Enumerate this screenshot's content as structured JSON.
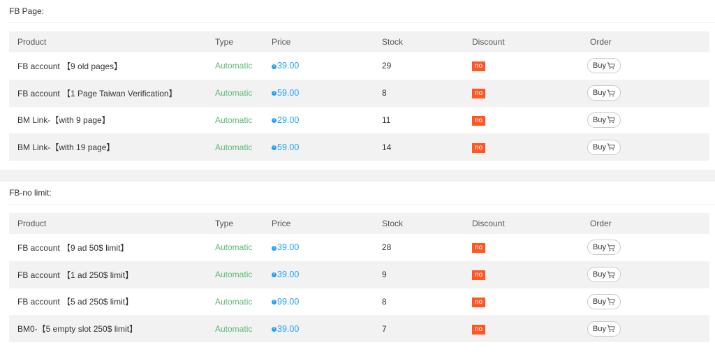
{
  "headers": [
    "Product",
    "Type",
    "Price",
    "Stock",
    "Discount",
    "Order"
  ],
  "sections": [
    {
      "title": "FB Page:",
      "rows": [
        {
          "product": "FB account 【9 old pages】",
          "type": "Automatic",
          "price": "39.00",
          "stock": "29",
          "discount": "no",
          "order": "Buy"
        },
        {
          "product": "FB account 【1 Page Taiwan Verification】",
          "type": "Automatic",
          "price": "59.00",
          "stock": "8",
          "discount": "no",
          "order": "Buy"
        },
        {
          "product": "BM Link-【with 9 page】",
          "type": "Automatic",
          "price": "29.00",
          "stock": "11",
          "discount": "no",
          "order": "Buy"
        },
        {
          "product": "BM Link-【with 19 page】",
          "type": "Automatic",
          "price": "59.00",
          "stock": "14",
          "discount": "no",
          "order": "Buy"
        }
      ]
    },
    {
      "title": "FB-no limit:",
      "rows": [
        {
          "product": "FB account 【9 ad 50$ limit】",
          "type": "Automatic",
          "price": "39.00",
          "stock": "28",
          "discount": "no",
          "order": "Buy"
        },
        {
          "product": "FB account 【1 ad 250$ limit】",
          "type": "Automatic",
          "price": "39.00",
          "stock": "9",
          "discount": "no",
          "order": "Buy"
        },
        {
          "product": "FB account 【5 ad 250$ limit】",
          "type": "Automatic",
          "price": "99.00",
          "stock": "8",
          "discount": "no",
          "order": "Buy"
        },
        {
          "product": "BM0-【5 empty slot 250$ limit】",
          "type": "Automatic",
          "price": "39.00",
          "stock": "7",
          "discount": "no",
          "order": "Buy"
        }
      ]
    }
  ],
  "icons": {
    "price": "info-icon",
    "order": "cart-icon"
  },
  "colors": {
    "type": "#5fb878",
    "price": "#1e9fff",
    "discount_badge": "#ff5722"
  }
}
